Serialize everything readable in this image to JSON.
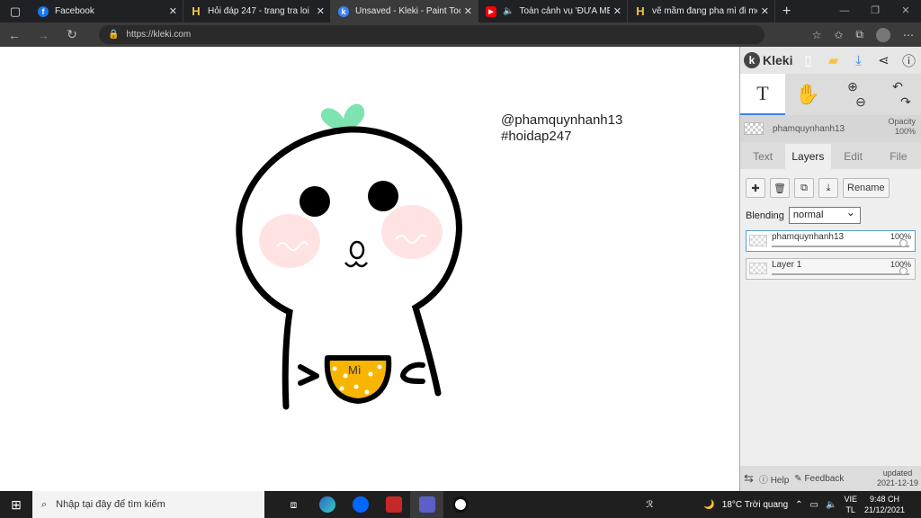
{
  "tabs": [
    {
      "title": "Facebook",
      "icon_color": "#1877f2",
      "icon": "f"
    },
    {
      "title": "Hỏi đáp 247 - trang tra loi",
      "icon_color": "#f4c542",
      "icon": "H"
    },
    {
      "title": "Unsaved - Kleki - Paint Tool",
      "icon_color": "#3b82f6",
      "icon": "k",
      "active": true
    },
    {
      "title": "Toàn cảnh vụ 'ĐƯA MÈO",
      "icon_color": "#ff0000",
      "icon": "▶"
    },
    {
      "title": "vẽ mầm đang pha mì đi mọi",
      "icon_color": "#f4c542",
      "icon": "H"
    }
  ],
  "address": {
    "url": "https://kleki.com"
  },
  "canvas": {
    "handle": "@phamquynhanh13",
    "hashtag": "#hoidap247",
    "bowl_text": "Mì"
  },
  "panel": {
    "app_name": "Kleki",
    "layer_name": "phamquynhanh13",
    "opacity_label": "Opacity",
    "opacity_value": "100%",
    "tabs": [
      "Text",
      "Layers",
      "Edit",
      "File"
    ],
    "rename_label": "Rename",
    "blending_label": "Blending",
    "blending_value": "normal",
    "layers": [
      {
        "name": "phamquynhanh13",
        "opacity": "100%"
      },
      {
        "name": "Layer 1",
        "opacity": "100%"
      }
    ],
    "help_label": "Help",
    "feedback_label": "Feedback",
    "updated_label": "updated",
    "updated_date": "2021-12-19"
  },
  "taskbar": {
    "search_placeholder": "Nhập tại đây để tìm kiếm",
    "weather": "18°C  Trời quang",
    "lang_top": "VIE",
    "lang_bottom": "TL",
    "time": "9:48 CH",
    "date": "21/12/2021"
  }
}
